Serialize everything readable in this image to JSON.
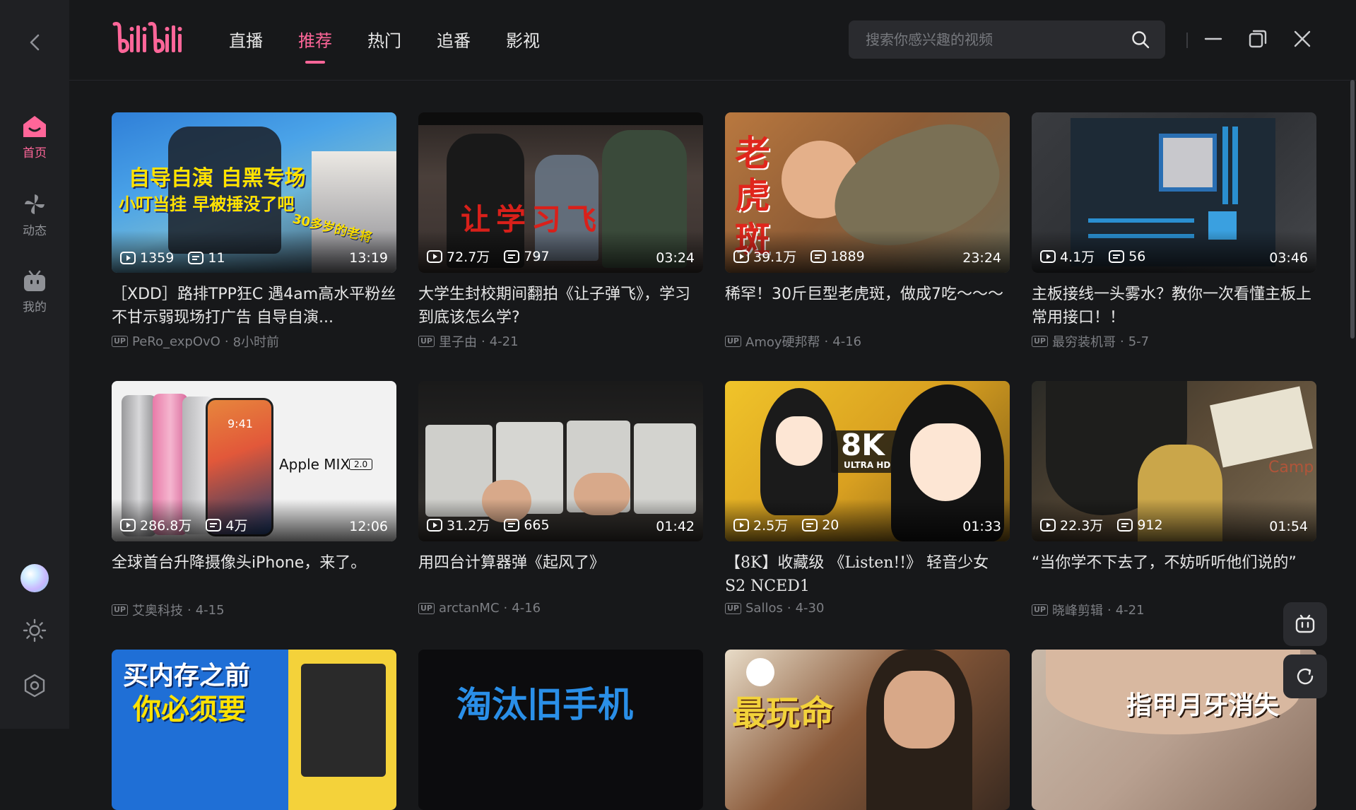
{
  "app": {
    "logo_text": "bilibili"
  },
  "rail": {
    "items": [
      {
        "label": "首页",
        "icon": "home-icon",
        "active": true
      },
      {
        "label": "动态",
        "icon": "pinwheel-icon",
        "active": false
      },
      {
        "label": "我的",
        "icon": "tv-icon",
        "active": false
      }
    ]
  },
  "header": {
    "tabs": [
      {
        "label": "直播"
      },
      {
        "label": "推荐",
        "active": true
      },
      {
        "label": "热门"
      },
      {
        "label": "追番"
      },
      {
        "label": "影视"
      }
    ],
    "search_placeholder": "搜索你感兴趣的视频"
  },
  "colors": {
    "accent": "#ff6699",
    "background": "#17181a",
    "rail": "#1f2023"
  },
  "videos": [
    {
      "views": "1359",
      "danmaku": "11",
      "duration": "13:19",
      "title": "［XDD］路排TPP狂C 遇4am高水平粉丝不甘示弱现场打广告 自导自演...",
      "up": "PeRo_expOvO",
      "date": "8小时前",
      "overlay": [
        "自导自演 自黑专场",
        "小叮当挂 早被捶没了吧",
        "30多岁的老将"
      ]
    },
    {
      "views": "72.7万",
      "danmaku": "797",
      "duration": "03:24",
      "title": "大学生封校期间翻拍《让子弹飞》，学习到底该怎么学?",
      "up": "里子由",
      "date": "4-21",
      "overlay": [
        "让学习飞"
      ]
    },
    {
      "views": "39.1万",
      "danmaku": "1889",
      "duration": "23:24",
      "title": "稀罕！30斤巨型老虎斑，做成7吃～～～",
      "up": "Amoy硬邦帮",
      "date": "4-16",
      "overlay": [
        "老",
        "虎",
        "斑"
      ]
    },
    {
      "views": "4.1万",
      "danmaku": "56",
      "duration": "03:46",
      "title": "主板接线一头雾水？教你一次看懂主板上常用接口！！",
      "up": "最穷装机哥",
      "date": "5-7",
      "overlay": []
    },
    {
      "views": "286.8万",
      "danmaku": "4万",
      "duration": "12:06",
      "title": "全球首台升降摄像头iPhone，来了。",
      "up": "艾奥科技",
      "date": "4-15",
      "overlay": [
        "Apple MIX",
        "2.0",
        "9:41"
      ]
    },
    {
      "views": "31.2万",
      "danmaku": "665",
      "duration": "01:42",
      "title": "用四台计算器弹《起风了》",
      "up": "arctanMC",
      "date": "4-16",
      "overlay": []
    },
    {
      "views": "2.5万",
      "danmaku": "20",
      "duration": "01:33",
      "title": "【8K】收藏级 《Listen!!》 轻音少女 S2 NCED1",
      "up": "Sallos",
      "date": "4-30",
      "overlay": [
        "8K",
        "ULTRA HD"
      ]
    },
    {
      "views": "22.3万",
      "danmaku": "912",
      "duration": "01:54",
      "title": "“当你学不下去了，不妨听听他们说的”",
      "up": "晓峰剪辑",
      "date": "4-21",
      "overlay": [
        "Camp"
      ]
    },
    {
      "overlay": [
        "买内存之前",
        "你必须要"
      ]
    },
    {
      "overlay": [
        "淘汰旧手机"
      ]
    },
    {
      "overlay": [
        "最玩命"
      ]
    },
    {
      "overlay": [
        "指甲月牙消失"
      ]
    }
  ],
  "up_badge": "UP"
}
